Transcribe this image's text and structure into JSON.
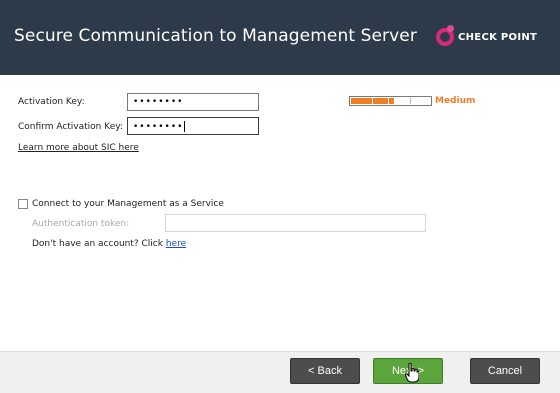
{
  "window": {
    "title": "Secure Communication to Management Server",
    "brand": "CHECK POINT"
  },
  "form": {
    "activation_key_label": "Activation Key:",
    "activation_key_value": "••••••••",
    "confirm_key_label": "Confirm Activation Key:",
    "confirm_key_value": "••••••••",
    "strength_label": "Medium",
    "strength_level": 0.55,
    "learn_more_link": "Learn more about SIC here",
    "maas_checkbox_label": "Connect to your Management as a Service",
    "maas_checked": false,
    "auth_token_label": "Authentication token:",
    "auth_token_value": "",
    "no_account_text": "Don't have an account? Click ",
    "no_account_link": "here"
  },
  "footer": {
    "back_label": "< Back",
    "next_label": "Next >",
    "cancel_label": "Cancel"
  },
  "colors": {
    "header_bg": "#2d3a49",
    "accent_brand": "#d6287c",
    "strength_color": "#f07e26",
    "next_button": "#5ca53c",
    "button_dark": "#4d4d4d"
  }
}
